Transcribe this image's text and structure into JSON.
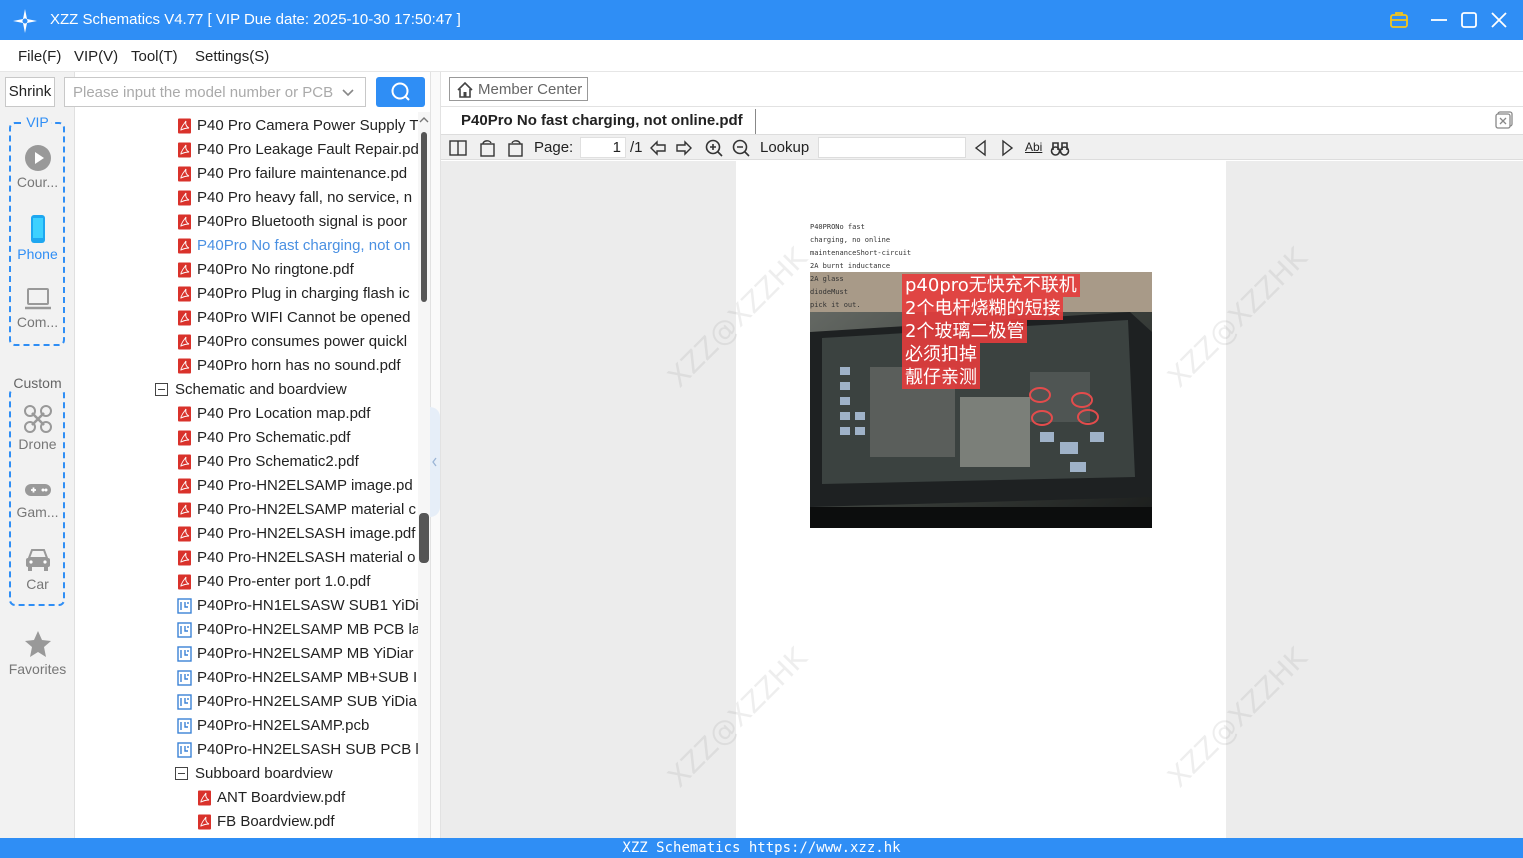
{
  "window": {
    "title": "XZZ Schematics V4.77 [ VIP Due date: 2025-10-30 17:50:47 ]"
  },
  "menu": {
    "file": "File(F)",
    "vip": "VIP(V)",
    "tool": "Tool(T)",
    "settings": "Settings(S)"
  },
  "sidebar": {
    "shrink": "Shrink",
    "vip_group": "VIP",
    "course": "Cour...",
    "phone": "Phone",
    "computer": "Com...",
    "custom_group": "Custom",
    "drone": "Drone",
    "game": "Gam...",
    "car": "Car",
    "favorites": "Favorites"
  },
  "search": {
    "placeholder": "Please input the model number or PCB"
  },
  "tree": {
    "items": [
      {
        "label": "P40 Pro Camera Power Supply T",
        "type": "pdf"
      },
      {
        "label": "P40 Pro Leakage Fault Repair.pd",
        "type": "pdf"
      },
      {
        "label": "P40 Pro failure maintenance.pd",
        "type": "pdf"
      },
      {
        "label": "P40 Pro heavy fall, no service, n",
        "type": "pdf"
      },
      {
        "label": "P40Pro Bluetooth signal is poor",
        "type": "pdf"
      },
      {
        "label": "P40Pro No fast charging, not on",
        "type": "pdf",
        "selected": true
      },
      {
        "label": "P40Pro No ringtone.pdf",
        "type": "pdf"
      },
      {
        "label": "P40Pro Plug in charging flash ic",
        "type": "pdf"
      },
      {
        "label": "P40Pro WIFI Cannot be opened",
        "type": "pdf"
      },
      {
        "label": "P40Pro consumes power quickl",
        "type": "pdf"
      },
      {
        "label": "P40Pro horn has no sound.pdf",
        "type": "pdf"
      },
      {
        "label": "Schematic and boardview",
        "type": "folder"
      },
      {
        "label": "P40 Pro Location map.pdf",
        "type": "pdf"
      },
      {
        "label": "P40 Pro Schematic.pdf",
        "type": "pdf"
      },
      {
        "label": "P40 Pro Schematic2.pdf",
        "type": "pdf"
      },
      {
        "label": "P40 Pro-HN2ELSAMP image.pd",
        "type": "pdf"
      },
      {
        "label": "P40 Pro-HN2ELSAMP material c",
        "type": "pdf"
      },
      {
        "label": "P40 Pro-HN2ELSASH image.pdf",
        "type": "pdf"
      },
      {
        "label": "P40 Pro-HN2ELSASH material o",
        "type": "pdf"
      },
      {
        "label": "P40 Pro-enter port 1.0.pdf",
        "type": "pdf"
      },
      {
        "label": "P40Pro-HN1ELSASW SUB1 YiDi",
        "type": "pcb"
      },
      {
        "label": "P40Pro-HN2ELSAMP MB PCB la",
        "type": "pcb"
      },
      {
        "label": "P40Pro-HN2ELSAMP MB YiDiar",
        "type": "pcb"
      },
      {
        "label": "P40Pro-HN2ELSAMP MB+SUB I",
        "type": "pcb"
      },
      {
        "label": "P40Pro-HN2ELSAMP SUB YiDia",
        "type": "pcb"
      },
      {
        "label": "P40Pro-HN2ELSAMP.pcb",
        "type": "pcb"
      },
      {
        "label": "P40Pro-HN2ELSASH SUB PCB la",
        "type": "pcb"
      },
      {
        "label": "Subboard boardview",
        "type": "folder2"
      },
      {
        "label": "ANT Boardview.pdf",
        "type": "pdf2"
      },
      {
        "label": "FB Boardview.pdf",
        "type": "pdf2"
      }
    ]
  },
  "viewer": {
    "member_center": "Member Center",
    "tab_title": "P40Pro No fast charging, not online.pdf",
    "page_label": "Page:",
    "page_value": "1",
    "page_total": "/1",
    "lookup_label": "Lookup",
    "abi_label": "Abi",
    "pdf_text": [
      "P40PRONo fast",
      "charging, no online",
      "maintenanceShort-circuit",
      "2A burnt inductance",
      "2A glass",
      "diodeMust",
      "pick it out."
    ],
    "photo_caption": [
      "p40pro无快充不联机",
      "2个电杆烧糊的短接",
      "2个玻璃二极管",
      "必须扣掉",
      "靓仔亲测"
    ],
    "watermark": "XZZ@XZZHK"
  },
  "status": {
    "text": "XZZ Schematics https://www.xzz.hk"
  },
  "colors": {
    "accent": "#2f8ef5",
    "selected_text": "#4a90e2",
    "pdf_icon": "#d9322b",
    "pcb_icon": "#3b82d6"
  }
}
